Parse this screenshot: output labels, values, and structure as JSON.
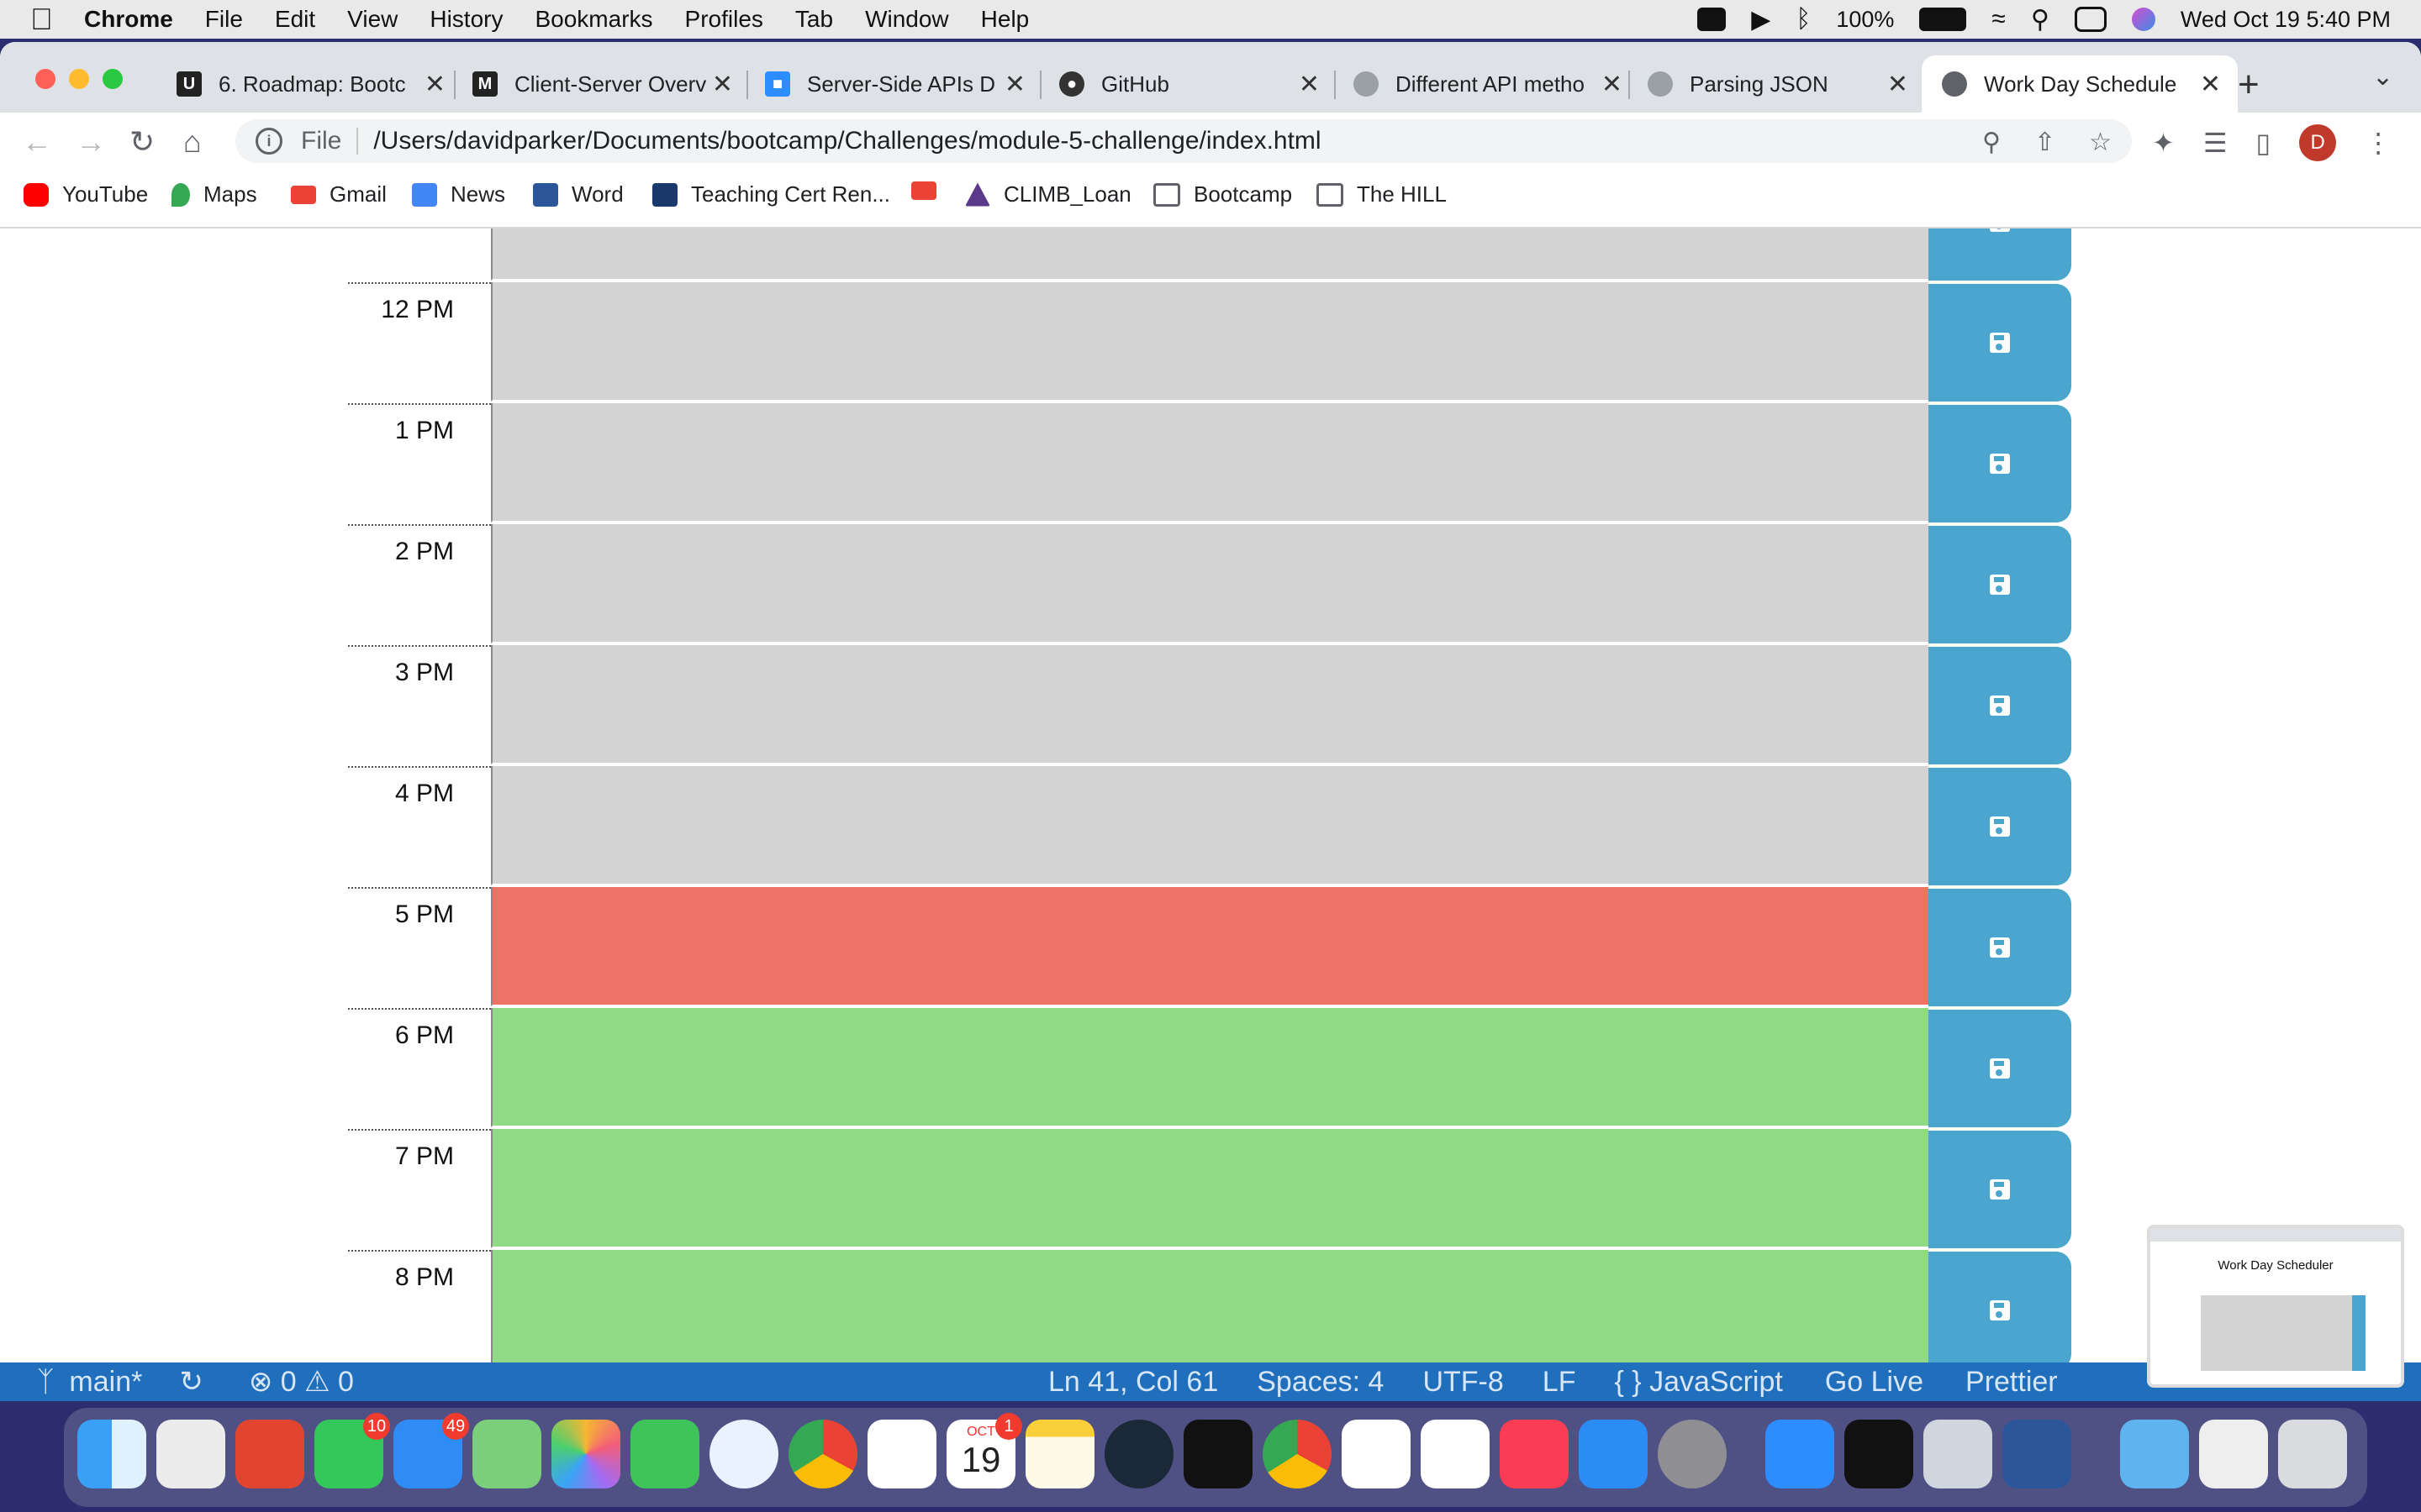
{
  "menubar": {
    "app": "Chrome",
    "items": [
      "File",
      "Edit",
      "View",
      "History",
      "Bookmarks",
      "Profiles",
      "Tab",
      "Window",
      "Help"
    ],
    "battery": "100%",
    "datetime": "Wed Oct 19  5:40 PM"
  },
  "tabs": [
    {
      "title": "6. Roadmap: Bootc",
      "fav": "U",
      "color": "#222222"
    },
    {
      "title": "Client-Server Overv",
      "fav": "M",
      "color": "#222222"
    },
    {
      "title": "Server-Side APIs D",
      "fav": "■",
      "color": "#2d8cff"
    },
    {
      "title": "GitHub",
      "fav": "●",
      "color": "#333333"
    },
    {
      "title": "Different API metho",
      "fav": "●",
      "color": "#9aa0a6"
    },
    {
      "title": "Parsing JSON",
      "fav": "●",
      "color": "#9aa0a6"
    },
    {
      "title": "Work Day Schedule",
      "fav": "●",
      "color": "#5f6368"
    }
  ],
  "omnibox": {
    "scheme": "File",
    "url": "/Users/davidparker/Documents/bootcamp/Challenges/module-5-challenge/index.html"
  },
  "profile": "D",
  "bookmarks": [
    {
      "label": "YouTube",
      "color": "#ff0000"
    },
    {
      "label": "Maps",
      "color": "#34a853"
    },
    {
      "label": "Gmail",
      "color": "#ea4335"
    },
    {
      "label": "News",
      "color": "#4285f4"
    },
    {
      "label": "Word",
      "color": "#2b579a"
    },
    {
      "label": "Teaching Cert Ren...",
      "color": "#1b3a6b"
    },
    {
      "label": "",
      "color": "#ea4335"
    },
    {
      "label": "CLIMB_Loan",
      "color": "#5b3a8c"
    },
    {
      "label": "Bootcamp",
      "color": "#5f6368"
    },
    {
      "label": "The HILL",
      "color": "#5f6368"
    }
  ],
  "scheduler": {
    "rows": [
      {
        "hour": "",
        "state": "past"
      },
      {
        "hour": "12 PM",
        "state": "past"
      },
      {
        "hour": "1 PM",
        "state": "past"
      },
      {
        "hour": "2 PM",
        "state": "past"
      },
      {
        "hour": "3 PM",
        "state": "past"
      },
      {
        "hour": "4 PM",
        "state": "past"
      },
      {
        "hour": "5 PM",
        "state": "present"
      },
      {
        "hour": "6 PM",
        "state": "future"
      },
      {
        "hour": "7 PM",
        "state": "future"
      },
      {
        "hour": "8 PM",
        "state": "future"
      }
    ],
    "colors": {
      "past": "#d3d3d3",
      "present": "#ee7366",
      "future": "#8fd987",
      "save": "#4aa5cf"
    }
  },
  "vscode_status": {
    "branch": "main*",
    "problems": "⊗ 0 ⚠ 0",
    "position": "Ln 41, Col 61",
    "spaces": "Spaces: 4",
    "encoding": "UTF-8",
    "eol": "LF",
    "language": "{ } JavaScript",
    "golive": "Go Live",
    "prettier": "Prettier"
  },
  "thumbnail": {
    "title": "Work Day Scheduler"
  },
  "dock": {
    "badges": {
      "messages": "10",
      "mail": "49",
      "calendar": "1"
    },
    "calendar_month": "OCT",
    "calendar_day": "19"
  }
}
